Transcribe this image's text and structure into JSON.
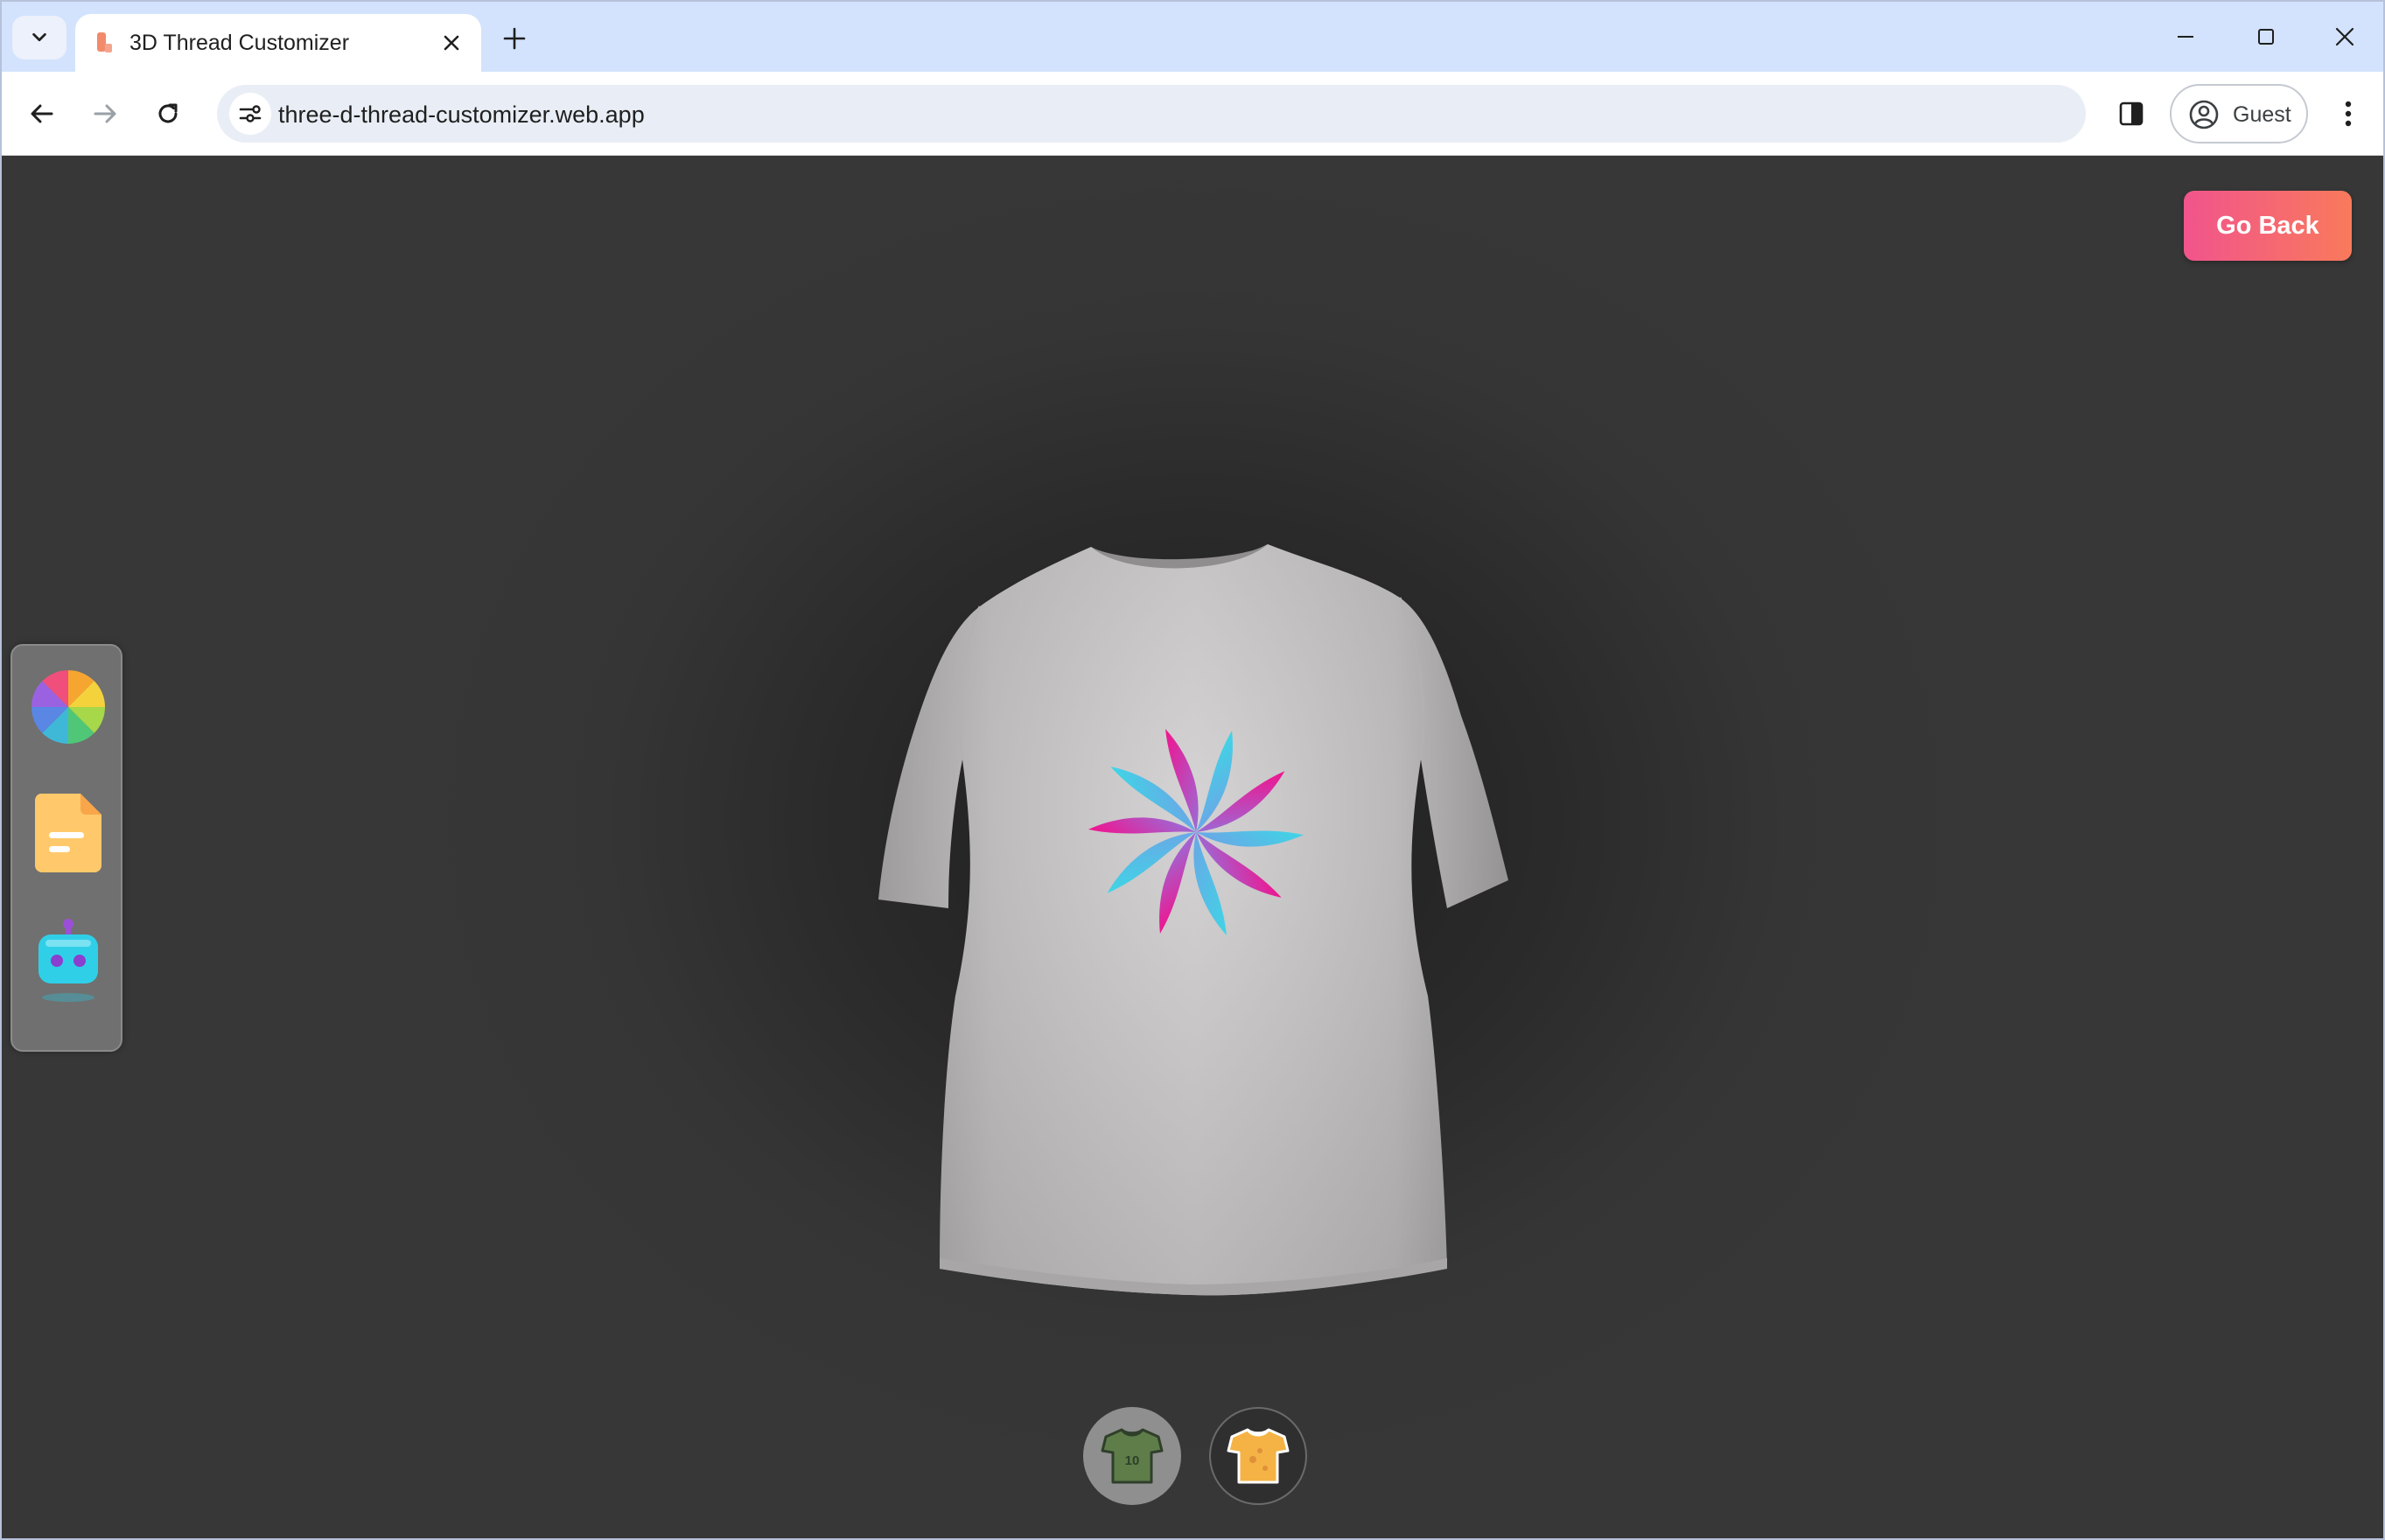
{
  "browser": {
    "tab_title": "3D Thread Customizer",
    "url": "three-d-thread-customizer.web.app",
    "profile_label": "Guest"
  },
  "app": {
    "go_back_label": "Go Back",
    "shirt_color": "#c9c7c8",
    "accent_gradient": [
      "#f1548c",
      "#f97a5b"
    ],
    "editor_tabs": [
      {
        "name": "colorpicker",
        "icon": "color-wheel-icon"
      },
      {
        "name": "filepicker",
        "icon": "file-icon"
      },
      {
        "name": "aipicker",
        "icon": "ai-robot-icon"
      }
    ],
    "filter_tabs": [
      {
        "name": "logoShirt",
        "icon": "logo-shirt-icon",
        "active": true
      },
      {
        "name": "stylishShirt",
        "icon": "stylish-shirt-icon",
        "active": false
      }
    ]
  }
}
